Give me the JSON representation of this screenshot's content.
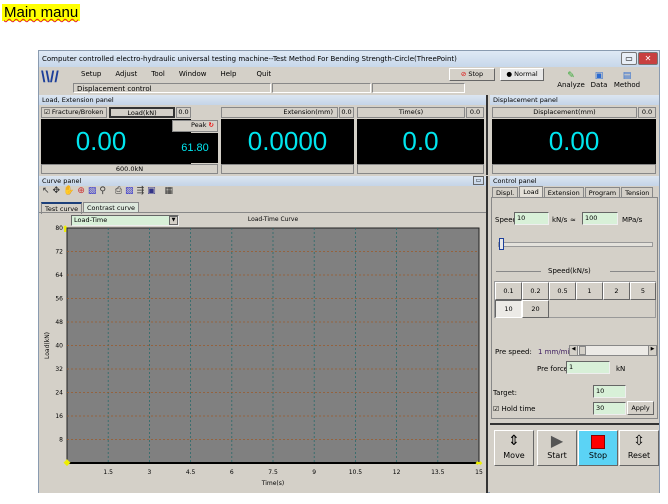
{
  "caption": "Main manu",
  "window": {
    "title": "Computer controlled electro-hydraulic universal testing machine--Test Method For Bending Strength-Circle(ThreePoint)"
  },
  "menu": [
    "Setup",
    "Adjust",
    "Tool",
    "Window",
    "Help",
    "Quit"
  ],
  "status": {
    "mode": "Displacement control",
    "stop_label": "Stop",
    "normal_label": "Normal"
  },
  "toolbar": {
    "analyze": "Analyze",
    "data": "Data",
    "method": "Method"
  },
  "load_panel": {
    "title": "Load, Extension panel",
    "fracture_label": "Fracture/Broken",
    "fracture_checked": true,
    "load_header": "Load(kN)",
    "load_small": "0.0",
    "load_value": "0.00",
    "peak_label": "Peak",
    "peak_value": "61.80",
    "range": "600.0kN",
    "extension_header": "Extension(mm)",
    "extension_small": "0.0",
    "extension_value": "0.0000",
    "time_header": "Time(s)",
    "time_small": "0.0",
    "time_value": "0.0"
  },
  "displacement_panel": {
    "title": "Displacement panel",
    "header": "Displacement(mm)",
    "small": "0.0",
    "value": "0.00"
  },
  "curve_panel": {
    "title": "Curve panel",
    "tabs": [
      "Test curve",
      "Contrast curve"
    ],
    "curve_select": "Load-Time"
  },
  "chart_data": {
    "type": "line",
    "title": "Load-Time Curve",
    "xlabel": "Time(s)",
    "ylabel": "Load(kN)",
    "xlim": [
      0,
      15
    ],
    "ylim": [
      0,
      80
    ],
    "xticks": [
      1.5,
      3,
      4.5,
      6,
      7.5,
      9,
      10.5,
      12,
      13.5,
      15
    ],
    "yticks": [
      8,
      16,
      24,
      32,
      40,
      48,
      56,
      64,
      72,
      80
    ],
    "grid": true,
    "series": [],
    "background": "#808080"
  },
  "control_panel": {
    "title": "Control panel",
    "tabs": [
      "Displ.",
      "Load",
      "Extension",
      "Program",
      "Tension"
    ],
    "active_tab": "Load",
    "speed_label": "Speed",
    "speed_value": "10",
    "speed_unit": "kN/s",
    "approx": "≈",
    "stress_value": "100",
    "stress_unit": "MPa/s",
    "speed_group": "Speed(kN/s)",
    "speed_buttons": [
      "0.1",
      "0.2",
      "0.5",
      "1",
      "2",
      "5",
      "10",
      "20"
    ],
    "selected_speed": "10",
    "pre_speed_label": "Pre speed:",
    "pre_speed_value": "1 mm/min",
    "pre_force_label": "Pre force:",
    "pre_force_value": "1",
    "pre_force_unit": "kN",
    "target_label": "Target:",
    "target_value": "10",
    "hold_label": "Hold time",
    "hold_checked": true,
    "hold_value": "30",
    "apply": "Apply"
  },
  "actions": {
    "move": "Move",
    "start": "Start",
    "stop": "Stop",
    "reset": "Reset"
  },
  "colors": {
    "digits": "#00e5ee",
    "stop_active": "#5bd3f5",
    "stop_square": "#ff0000",
    "plot_bg": "#808080"
  }
}
